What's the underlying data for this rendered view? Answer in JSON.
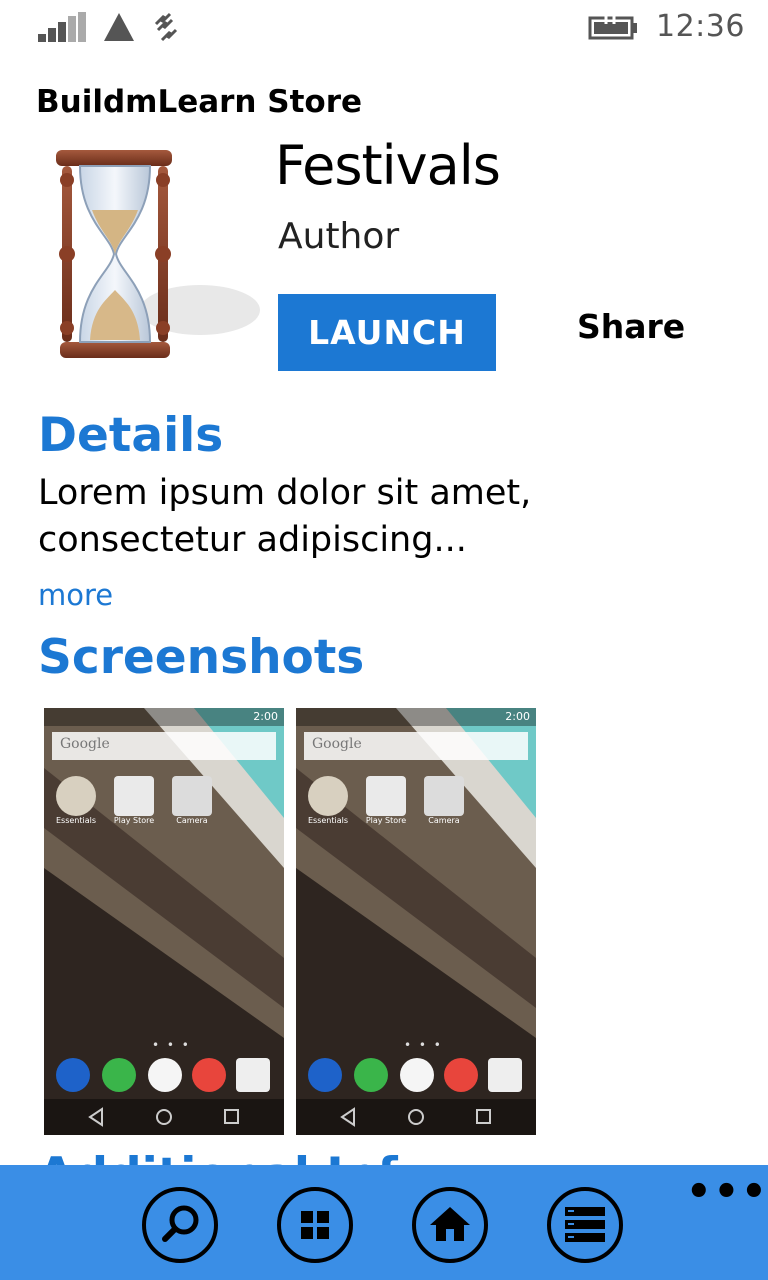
{
  "status_bar": {
    "time": "12:36"
  },
  "header": {
    "title": "BuildmLearn Store"
  },
  "app": {
    "name": "Festivals",
    "author": "Author",
    "launch_label": "LAUNCH",
    "share_label": "Share"
  },
  "details": {
    "heading": "Details",
    "description": "Lorem ipsum dolor sit amet, consectetur adipiscing...",
    "more_label": "more"
  },
  "screenshots": {
    "heading": "Screenshots",
    "items": [
      {
        "time": "2:00",
        "search_text": "Google",
        "apps": [
          "Essentials",
          "Play Store",
          "Camera"
        ]
      },
      {
        "time": "2:00",
        "search_text": "Google",
        "apps": [
          "Essentials",
          "Play Store",
          "Camera"
        ]
      }
    ]
  },
  "additional": {
    "heading_partial": "Additional Inf"
  },
  "app_bar": {
    "buttons": [
      "search-icon",
      "grid-icon",
      "home-icon",
      "list-icon"
    ],
    "more": "•••"
  },
  "colors": {
    "accent": "#1c78d3",
    "app_bar": "#3a8ee6"
  }
}
